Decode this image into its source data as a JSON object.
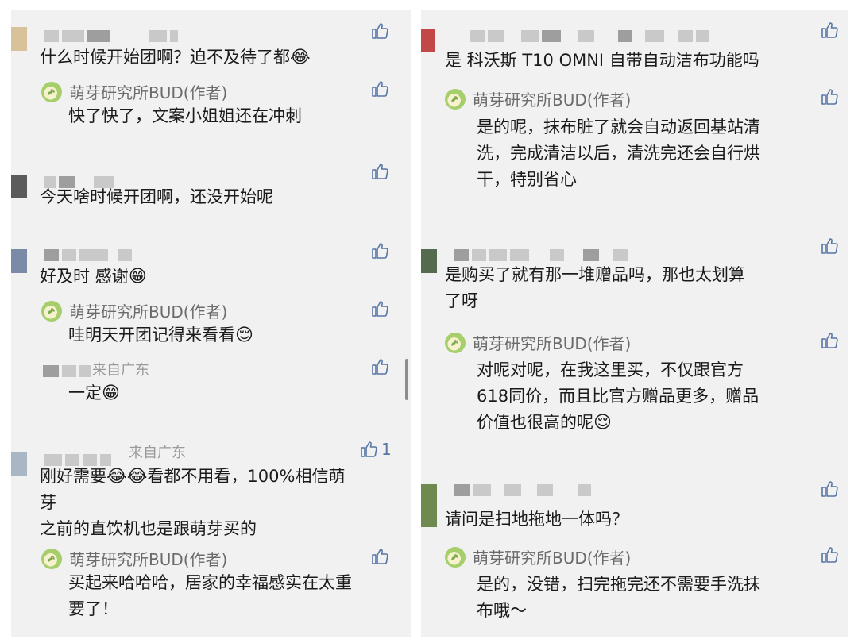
{
  "left": {
    "c1": {
      "text": "什么时候开始团啊？迫不及待了都",
      "emoji": "😂",
      "reply": {
        "author": "萌芽研究所BUD(作者)",
        "text": "快了快了，文案小姐姐还在冲刺"
      }
    },
    "c2": {
      "text": "今天啥时候开团啊，还没开始呢"
    },
    "c3": {
      "text": "好及时 感谢",
      "emoji": "😁",
      "reply": {
        "author": "萌芽研究所BUD(作者)",
        "text": "哇明天开团记得来看看",
        "emoji": "😌"
      },
      "sub": {
        "location": "来自广东",
        "text": "一定",
        "emoji": "😁"
      }
    },
    "c4": {
      "location": "来自广东",
      "likes": "1",
      "text_a": "刚好需要",
      "emoji_a": "😂😂",
      "text_b": "看都不用看，100%相信萌",
      "line2": "芽",
      "line3": "之前的直饮机也是跟萌芽买的",
      "reply": {
        "author": "萌芽研究所BUD(作者)",
        "line1": "买起来哈哈哈，居家的幸福感实在太重",
        "line2": "要了！"
      }
    }
  },
  "right": {
    "c1": {
      "text": "是 科沃斯 T10 OMNI 自带自动洁布功能吗",
      "reply": {
        "author": "萌芽研究所BUD(作者)",
        "line1": "是的呢，抹布脏了就会自动返回基站清",
        "line2": "洗，完成清洁以后，清洗完还会自行烘",
        "line3": "干，特别省心"
      }
    },
    "c2": {
      "line1": "是购买了就有那一堆赠品吗，那也太划算",
      "line2": "了呀",
      "reply": {
        "author": "萌芽研究所BUD(作者)",
        "line1": "对呢对呢，在我这里买，不仅跟官方",
        "line2": "618同价，而且比官方赠品更多，赠品",
        "line3": "价值也很高的呢",
        "emoji": "😌"
      }
    },
    "c3": {
      "text": "请问是扫地拖地一体吗？",
      "reply": {
        "author": "萌芽研究所BUD(作者)",
        "line1": "是的，没错，扫完拖完还不需要手洗抹",
        "line2": "布哦～"
      }
    }
  },
  "icons": {
    "like": "thumbs-up-icon",
    "logo": "sprout-logo-icon"
  },
  "colors": {
    "like": "#5776a6",
    "author": "#6b6b6b",
    "location": "#9a9a9a",
    "panel": "#f1f1f1"
  }
}
